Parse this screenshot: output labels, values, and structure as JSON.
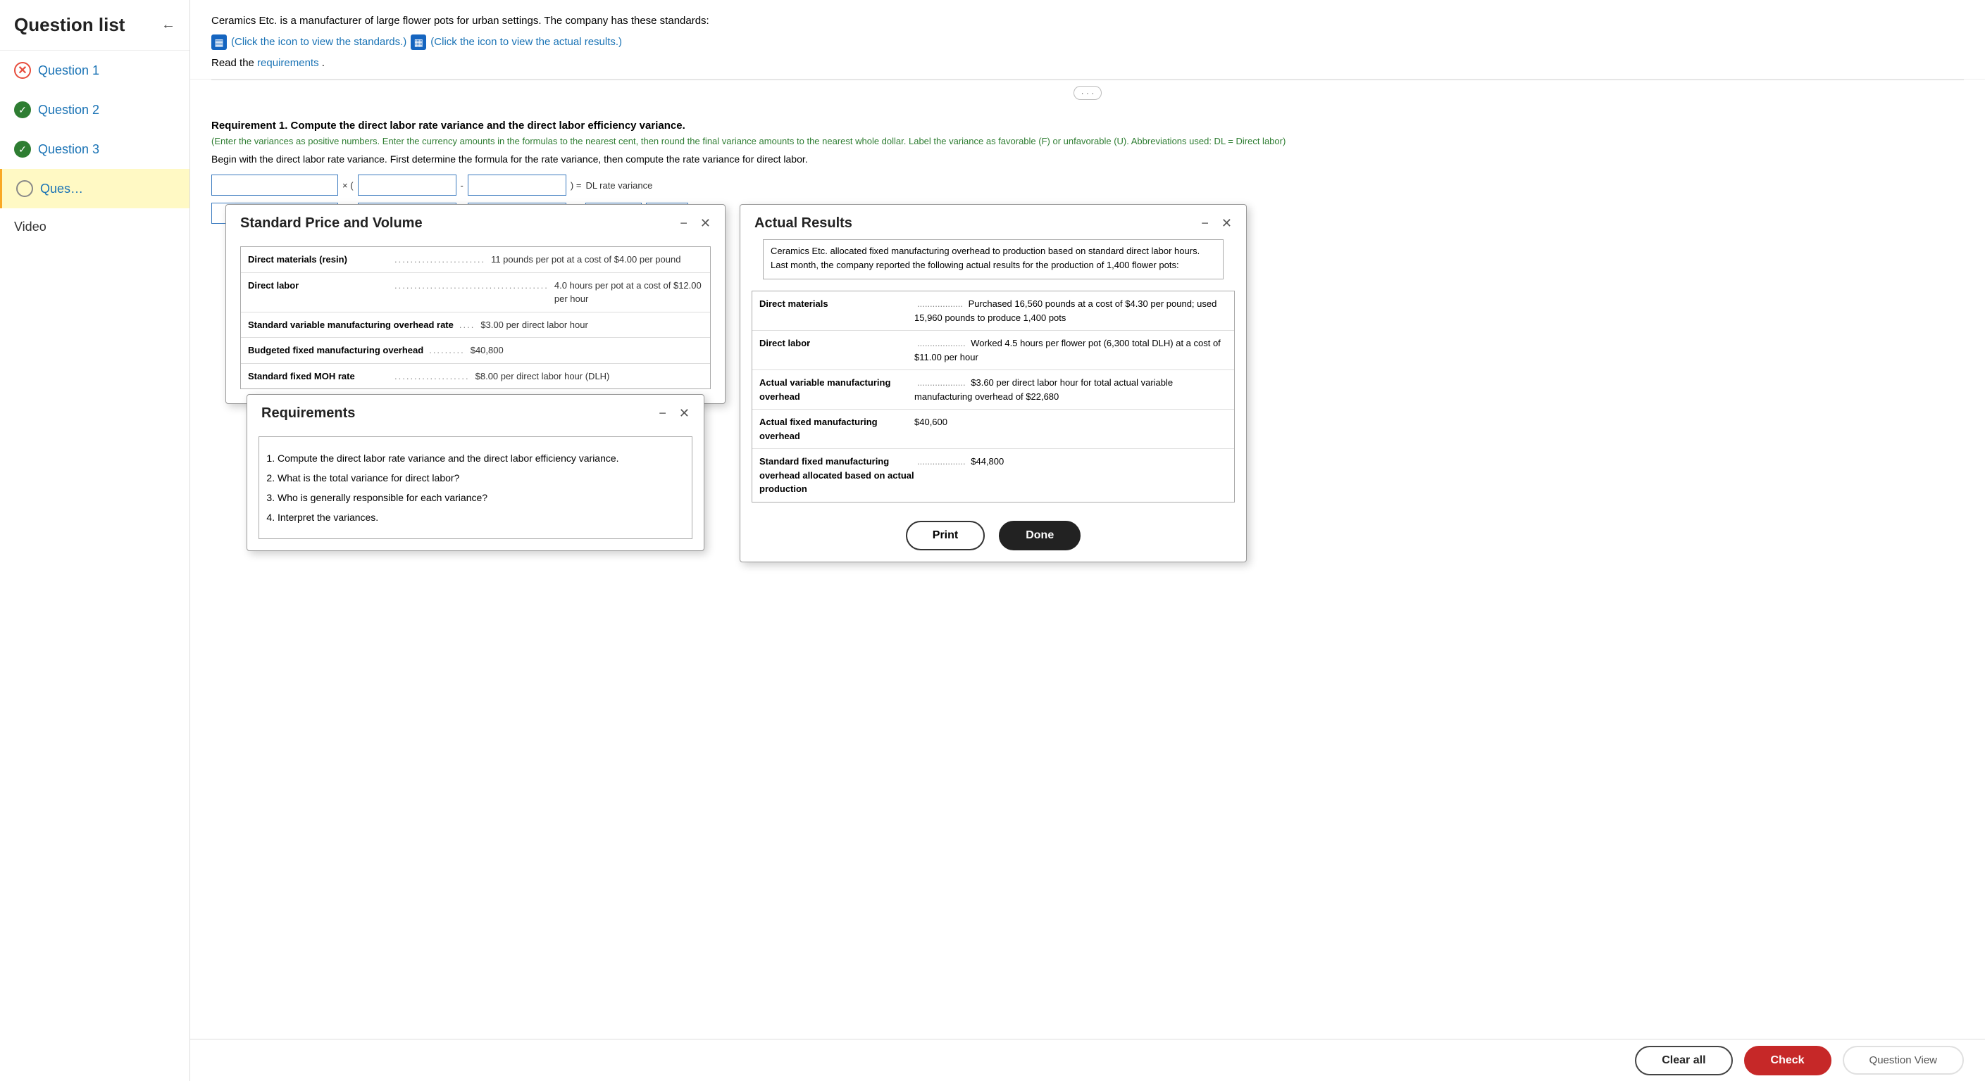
{
  "sidebar": {
    "title": "Question list",
    "collapse_label": "←",
    "items": [
      {
        "id": "q1",
        "label": "Question 1",
        "status": "slash"
      },
      {
        "id": "q2",
        "label": "Question 2",
        "status": "check"
      },
      {
        "id": "q3",
        "label": "Question 3",
        "status": "check"
      },
      {
        "id": "q4",
        "label": "Ques…",
        "status": "circle"
      }
    ],
    "video_label": "Video"
  },
  "problem": {
    "description": "Ceramics Etc. is a manufacturer of large flower pots for urban settings. The company has these standards:",
    "standards_link": "(Click the icon to view the standards.)",
    "results_link": "(Click the icon to view the actual results.)",
    "requirements_prefix": "Read the ",
    "requirements_link": "requirements",
    "requirements_suffix": "."
  },
  "requirement1": {
    "title": "Requirement 1.",
    "title_rest": " Compute the direct labor rate variance and the direct labor efficiency variance.",
    "note": "(Enter the variances as positive numbers. Enter the currency amounts in the formulas to the nearest cent, then round the final variance amounts to the nearest whole dollar. Label the variance as favorable (F) or unfavorable (U). Abbreviations used: DL = Direct labor)",
    "description": "Begin with the direct labor rate variance. First determine the formula for the rate variance, then compute the rate variance for direct labor.",
    "formula_label": "DL rate variance"
  },
  "standard_price_modal": {
    "title": "Standard Price and Volume",
    "rows": [
      {
        "label": "Direct materials (resin)",
        "dots": ".................",
        "value": "11 pounds per pot at a cost of $4.00 per pound"
      },
      {
        "label": "Direct labor",
        "dots": "...............................",
        "value": "4.0 hours per pot at a cost of $12.00 per hour"
      },
      {
        "label": "Standard variable manufacturing overhead rate",
        "dots": "....",
        "value": "$3.00 per direct labor hour"
      },
      {
        "label": "Budgeted fixed manufacturing overhead",
        "dots": ".........",
        "value": "$40,800"
      },
      {
        "label": "Standard fixed MOH rate",
        "dots": "...................",
        "value": "$8.00 per direct labor hour (DLH)"
      }
    ]
  },
  "requirements_modal": {
    "title": "Requirements",
    "items": [
      "Compute the direct labor rate variance and the direct labor efficiency variance.",
      "What is the total variance for direct labor?",
      "Who is generally responsible for each variance?",
      "Interpret the variances."
    ]
  },
  "actual_results_modal": {
    "title": "Actual Results",
    "intro": "Ceramics Etc. allocated fixed manufacturing overhead to production based on standard direct labor hours. Last month, the company reported the following actual results for the production of 1,400 flower pots:",
    "rows": [
      {
        "label": "Direct materials",
        "dots": "..................",
        "value": "Purchased 16,560 pounds at a cost of $4.30 per pound; used 15,960 pounds to produce 1,400 pots"
      },
      {
        "label": "Direct labor",
        "dots": "...................",
        "value": "Worked 4.5 hours per flower pot (6,300 total DLH) at a cost of $11.00 per hour"
      },
      {
        "label": "Actual variable manufacturing overhead",
        "dots": "...................",
        "value": "$3.60 per direct labor hour for total actual variable manufacturing overhead of $22,680"
      },
      {
        "label": "Actual fixed manufacturing overhead",
        "dots": "",
        "value": "$40,600"
      },
      {
        "label": "Standard fixed manufacturing overhead allocated based on actual production",
        "dots": "...................",
        "value": "$44,800"
      }
    ],
    "btn_print": "Print",
    "btn_done": "Done"
  },
  "bottom_bar": {
    "btn_clear_all": "Clear all",
    "btn_check": "Check",
    "btn_question_view": "Question View"
  }
}
